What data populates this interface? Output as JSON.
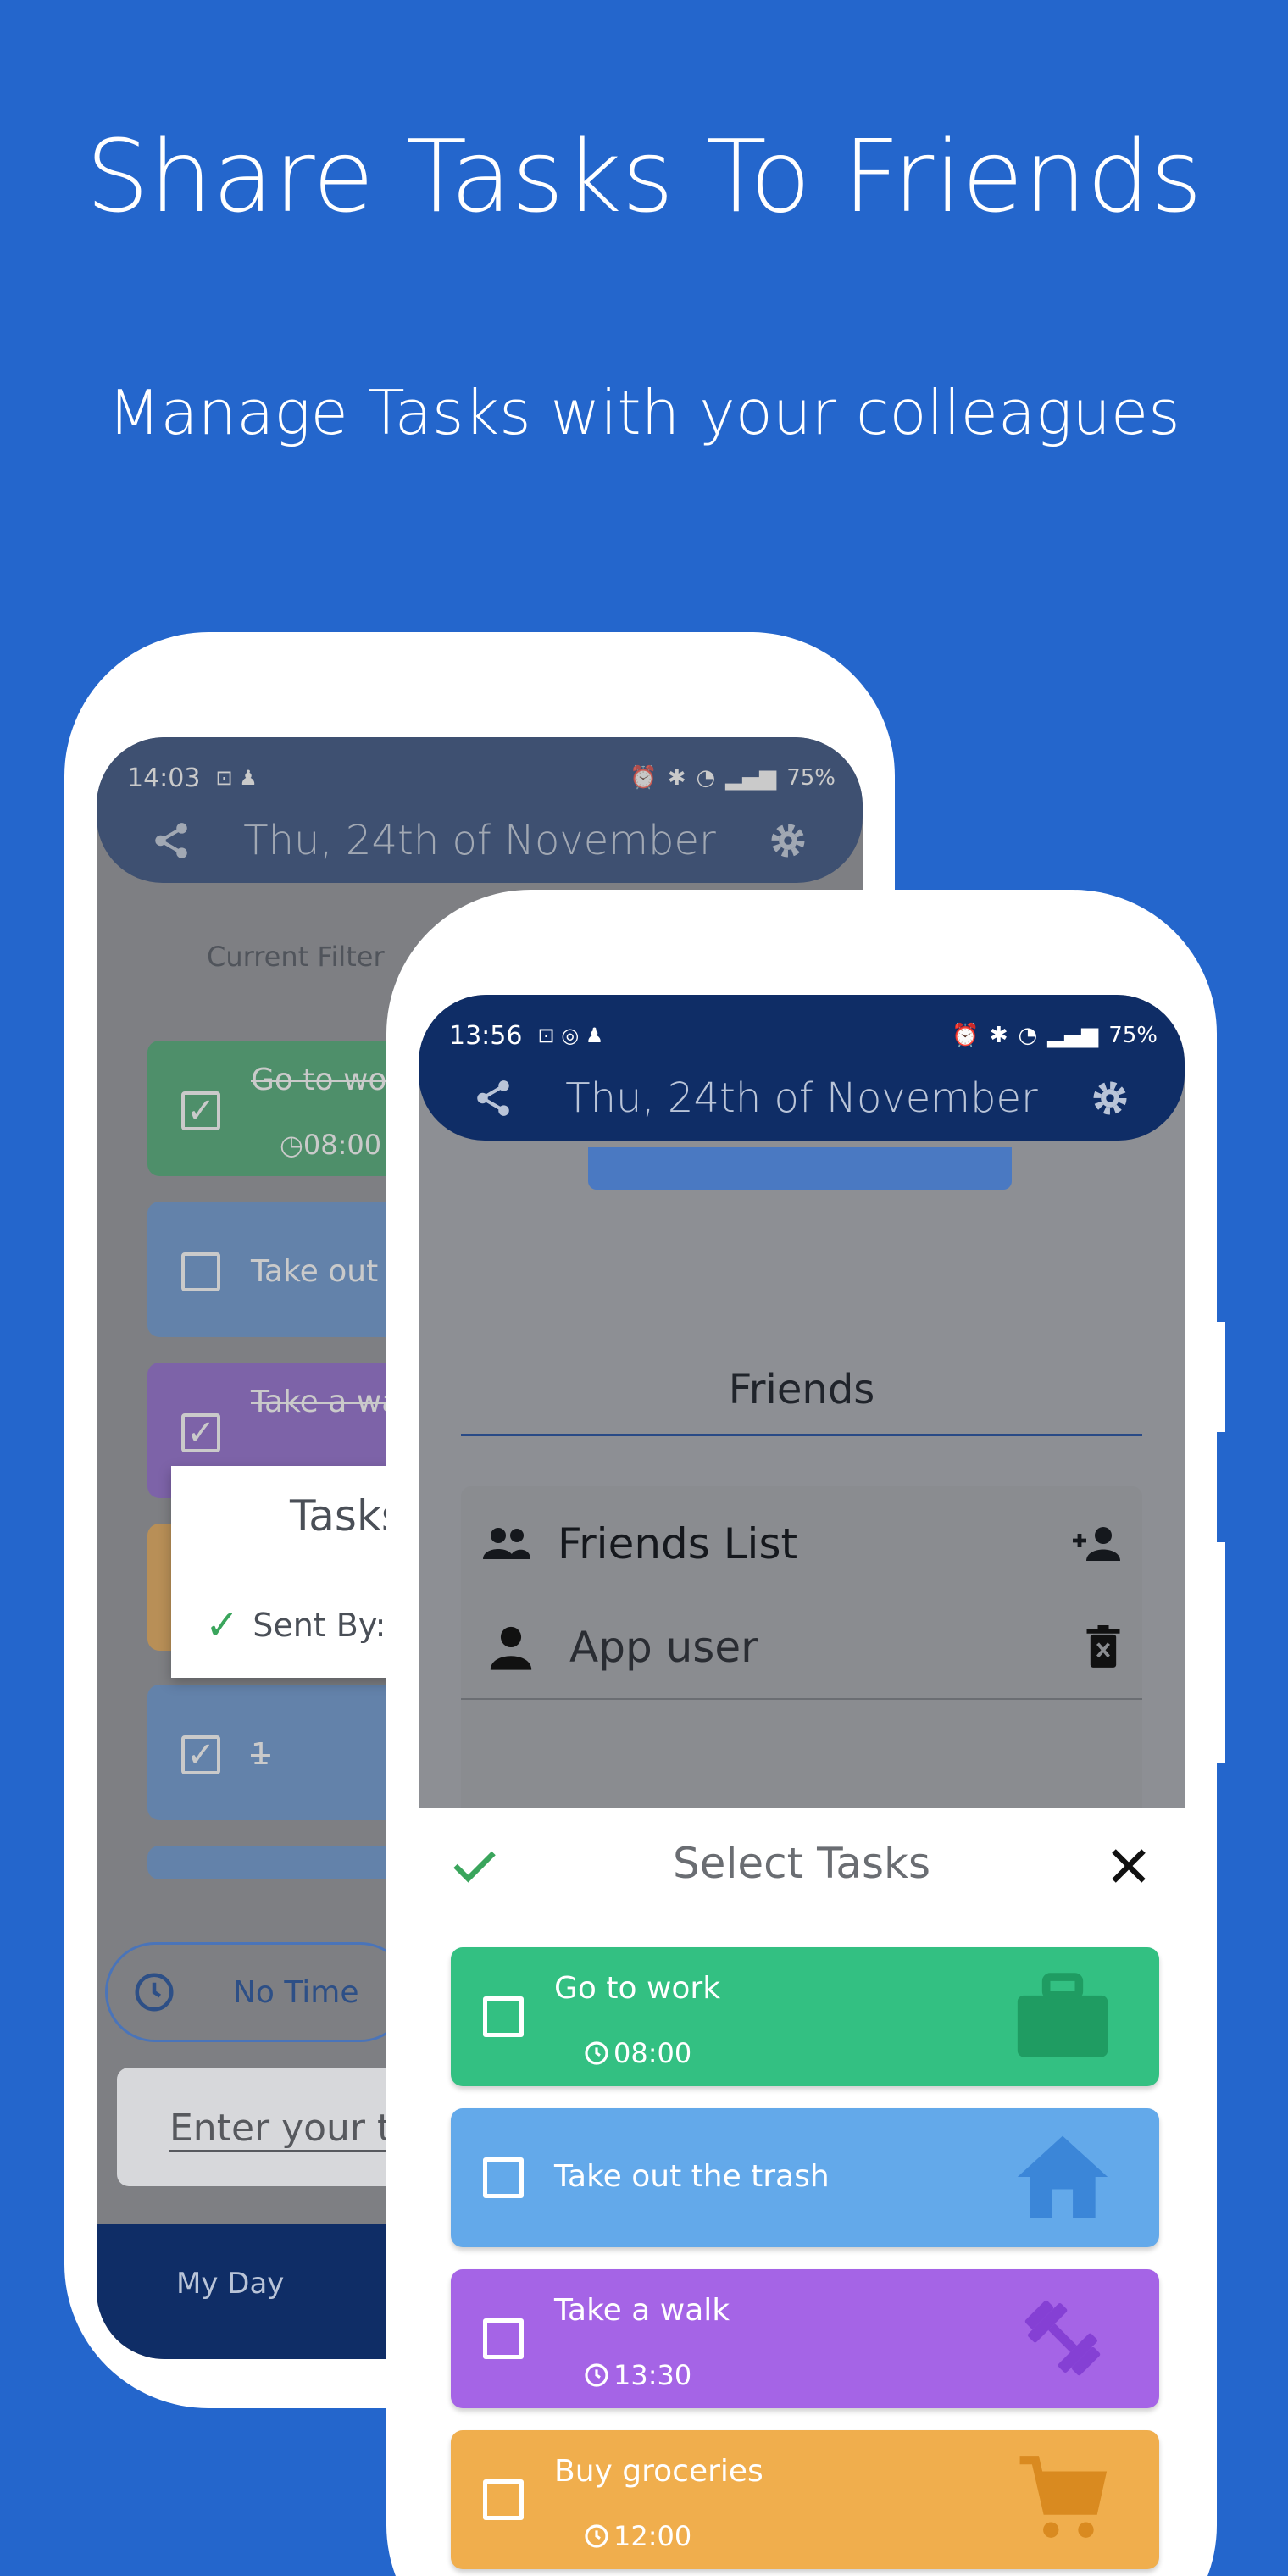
{
  "headline": "Share Tasks To Friends",
  "subline": "Manage Tasks with your colleagues",
  "back_phone": {
    "status": {
      "time": "14:03",
      "battery": "75%"
    },
    "toolbar": {
      "date": "Thu, 24th of November"
    },
    "filter_label": "Current Filter",
    "tasks": [
      {
        "title": "Go to work",
        "time": "08:00",
        "checked": true,
        "color": "#2a9a5a"
      },
      {
        "title": "Take out the trash",
        "checked": false,
        "color": "#4f84c8"
      },
      {
        "title": "Take a walk",
        "checked": true,
        "color": "#7a4fc4"
      },
      {
        "title": "1",
        "checked": true,
        "color": "#4f84c8"
      }
    ],
    "dialog": {
      "title": "Tasks",
      "sent_by": "Sent By: A"
    },
    "no_time": "No Time",
    "enter_placeholder": "Enter your ta",
    "nav": {
      "my_day": "My Day"
    }
  },
  "front_phone": {
    "status": {
      "time": "13:56",
      "battery": "75%"
    },
    "toolbar": {
      "date": "Thu, 24th of November"
    },
    "friends_header": "Friends",
    "friends_list_title": "Friends List",
    "friend_name": "App user",
    "sheet": {
      "title": "Select Tasks",
      "tasks": [
        {
          "title": "Go to work",
          "time": "08:00",
          "color": "#33c082",
          "icon": "briefcase-icon"
        },
        {
          "title": "Take out the trash",
          "time": "",
          "color": "#63a9ea",
          "icon": "home-icon"
        },
        {
          "title": "Take a walk",
          "time": "13:30",
          "color": "#a564e6",
          "icon": "dumbbell-icon"
        },
        {
          "title": "Buy groceries",
          "time": "12:00",
          "color": "#f0ae4d",
          "icon": "cart-icon"
        }
      ]
    }
  }
}
